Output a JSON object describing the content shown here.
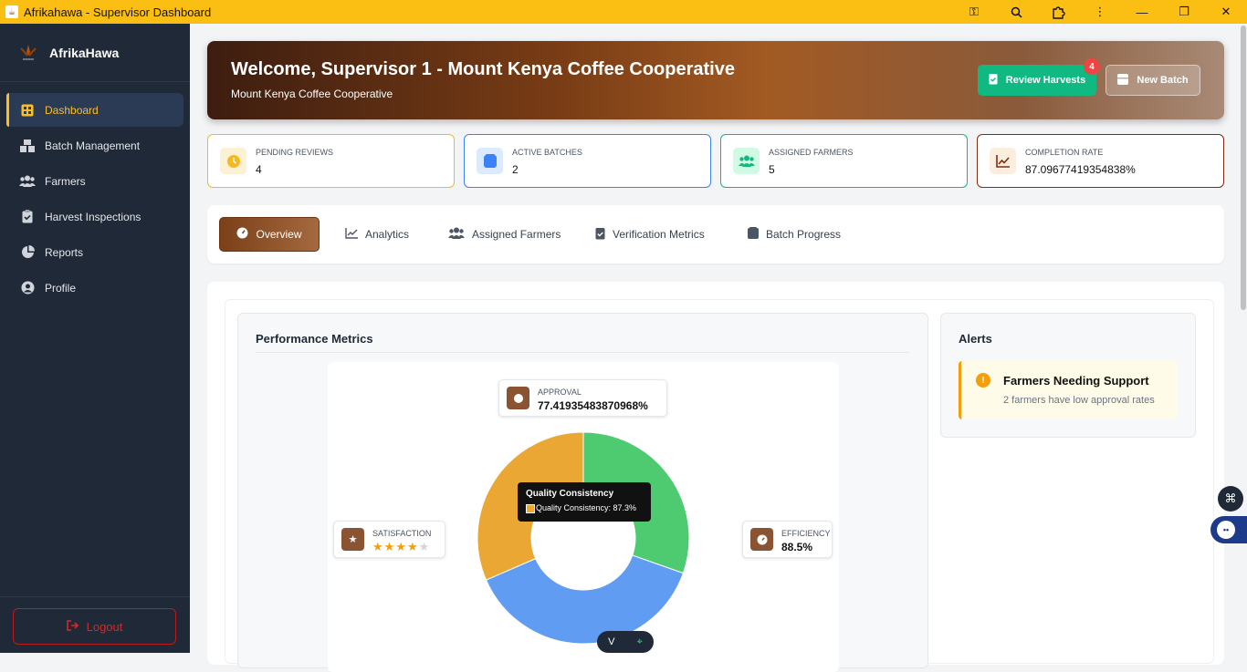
{
  "window": {
    "title": "Afrikahawa - Supervisor Dashboard",
    "controls": [
      "key-icon",
      "zoom-icon",
      "extension-icon",
      "more-icon",
      "minimize",
      "maximize",
      "close"
    ]
  },
  "sidebar": {
    "brand": "AfrikaHawa",
    "items": [
      {
        "label": "Dashboard",
        "icon": "grid-icon",
        "active": true
      },
      {
        "label": "Batch Management",
        "icon": "boxes-icon"
      },
      {
        "label": "Farmers",
        "icon": "users-icon"
      },
      {
        "label": "Harvest Inspections",
        "icon": "clipboard-check-icon"
      },
      {
        "label": "Reports",
        "icon": "pie-chart-icon"
      },
      {
        "label": "Profile",
        "icon": "user-circle-icon"
      }
    ],
    "logout": "Logout"
  },
  "hero": {
    "title": "Welcome, Supervisor 1 - Mount Kenya Coffee Cooperative",
    "subtitle": "Mount Kenya Coffee Cooperative",
    "review_label": "Review Harvests",
    "review_badge": "4",
    "new_batch_label": "New Batch"
  },
  "stats": [
    {
      "label": "PENDING REVIEWS",
      "value": "4",
      "color": "#f5b820",
      "icon": "clock-icon"
    },
    {
      "label": "ACTIVE BATCHES",
      "value": "2",
      "color": "#3b82f6",
      "icon": "box-icon"
    },
    {
      "label": "ASSIGNED FARMERS",
      "value": "5",
      "color": "#10b981",
      "icon": "users-icon"
    },
    {
      "label": "COMPLETION RATE",
      "value": "87.09677419354838%",
      "color": "#7c2d12",
      "icon": "chart-line-icon"
    }
  ],
  "tabs": [
    {
      "label": "Overview",
      "icon": "gauge-icon",
      "active": true
    },
    {
      "label": "Analytics",
      "icon": "chart-line-icon"
    },
    {
      "label": "Assigned Farmers",
      "icon": "users-icon"
    },
    {
      "label": "Verification Metrics",
      "icon": "clipboard-check-icon"
    },
    {
      "label": "Batch Progress",
      "icon": "box-icon"
    }
  ],
  "performance": {
    "title": "Performance Metrics",
    "approval": {
      "label": "APPROVAL",
      "value": "77.41935483870968%"
    },
    "satisfaction": {
      "label": "SATISFACTION",
      "stars": 4,
      "max_stars": 5
    },
    "efficiency": {
      "label": "EFFICIENCY",
      "value": "88.5%"
    },
    "tooltip": {
      "title": "Quality Consistency",
      "text": "Quality Consistency: 87.3%",
      "swatch": "#f0a830"
    }
  },
  "chart_data": {
    "type": "pie",
    "donut": true,
    "series": [
      {
        "color": "#4ecb71",
        "value": 30.4
      },
      {
        "color": "#619cf3",
        "value": 38.1
      },
      {
        "color": "#eaa734",
        "value": 31.5
      }
    ]
  },
  "alerts": {
    "title": "Alerts",
    "items": [
      {
        "title": "Farmers Needing Support",
        "text": "2 farmers have low approval rates"
      }
    ]
  }
}
